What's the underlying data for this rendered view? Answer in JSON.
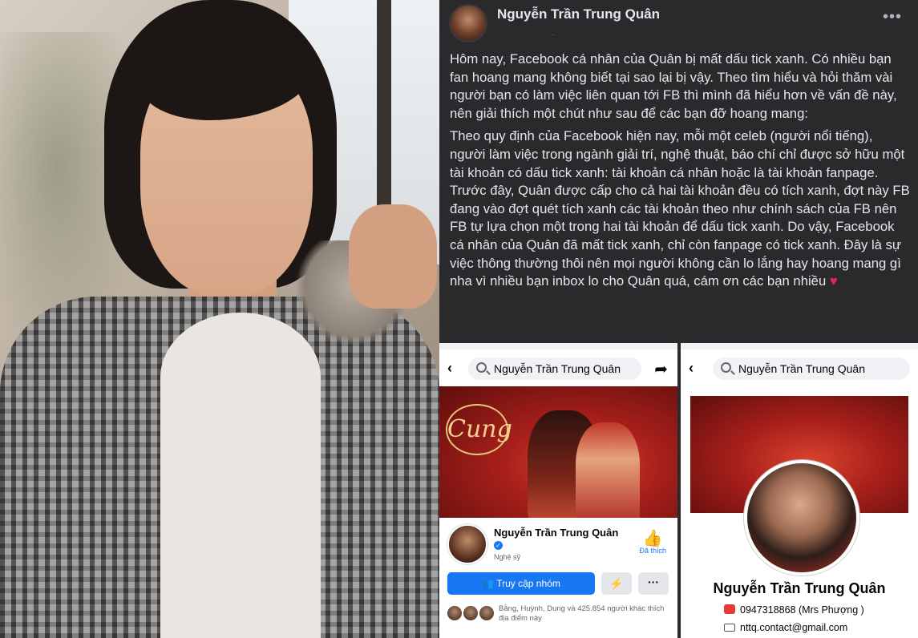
{
  "post": {
    "author": "Nguyễn Trần Trung Quân",
    "meta": "·",
    "more": "•••",
    "paragraph1": "Hôm nay, Facebook cá nhân của Quân bị mất dấu tick xanh. Có nhiều bạn fan hoang mang không biết tại sao lại bị vậy. Theo tìm hiểu và hỏi thăm vài người bạn có làm việc liên quan tới FB thì mình đã hiểu hơn về vấn đề này, nên giải thích một chút như sau để các bạn đỡ hoang mang:",
    "paragraph2": "Theo quy định của Facebook hiện nay, mỗi một celeb (người nổi tiếng), người làm việc trong ngành giải trí, nghệ thuật, báo chí chỉ được sở hữu một tài khoản có dấu tick xanh: tài khoản cá nhân hoặc là tài khoản fanpage. Trước đây, Quân được cấp cho cả hai tài khoản đều có tích xanh, đợt này FB đang vào đợt quét tích xanh các tài khoản theo như chính sách của FB nên FB tự lựa chọn một trong hai tài khoản để dấu tick xanh. Do vậy, Facebook cá nhân của Quân đã mất tick xanh, chỉ còn fanpage có tick xanh. Đây là sự việc thông thường thôi nên mọi người không cần lo lắng hay hoang mang gì nha vì nhiều bạn inbox lo cho Quân quá, cám ơn các bạn nhiều",
    "heart": "♥"
  },
  "card1": {
    "back": "‹",
    "search_text": "Nguyễn Trần Trung Quân",
    "share": "➦",
    "cover_logo": "Cung",
    "page_name": "Nguyễn Trần Trung Quân",
    "verified": "✓",
    "category": "Nghệ sỹ",
    "like_icon": "👍",
    "like_label": "Đã thích",
    "primary_button": "👥 Truy cập nhóm",
    "messenger_icon": "⚡",
    "more_icon": "···",
    "friends_text": "Bằng, Huỳnh, Dung và 425.854 người khác thích địa điểm này"
  },
  "card2": {
    "back": "‹",
    "search_text": "Nguyễn Trần Trung Quân",
    "profile_name": "Nguyễn Trần Trung Quân",
    "phone": "0947318868 (Mrs Phượng )",
    "email": "nttq.contact@gmail.com"
  },
  "colors": {
    "facebook_blue": "#1877f2",
    "post_background": "#2a2a2d",
    "heart": "#e0245e"
  }
}
